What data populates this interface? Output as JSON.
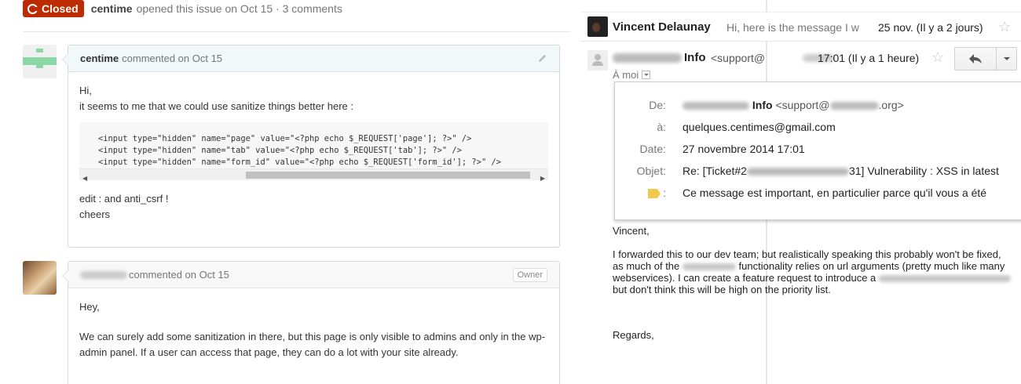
{
  "issue": {
    "state": "Closed",
    "author": "centime",
    "meta": "opened this issue on Oct 15 · 3 comments"
  },
  "comments": [
    {
      "author": "centime",
      "meta": "commented on Oct 15",
      "intro_1": "Hi,",
      "intro_2": "it seems to me that we could use sanitize things better here :",
      "code": "<input type=\"hidden\" name=\"page\" value=\"<?php echo $_REQUEST['page']; ?>\" />\n<input type=\"hidden\" name=\"tab\" value=\"<?php echo $_REQUEST['tab']; ?>\" />\n<input type=\"hidden\" name=\"form_id\" value=\"<?php echo $_REQUEST['form_id']; ?>\" />",
      "outro_1": "edit : and anti_csrf !",
      "outro_2": "cheers"
    },
    {
      "meta": "commented on Oct 15",
      "badge": "Owner",
      "p1": "Hey,",
      "p2": "We can surely add some sanitization in there, but this page is only visible to admins and only in the wp-admin panel. If a user can access that page, they can do a lot with your site already."
    }
  ],
  "mail": {
    "thread_sender": "Vincent Delaunay",
    "thread_snippet": "Hi, here is the message I w",
    "thread_date": "25 nov. (Il y a 2 jours)",
    "from_name": "Info",
    "from_addr": "<support@",
    "date": "17:01 (Il y a 1 heure)",
    "to_me": "À moi",
    "details": {
      "from_label": "De:",
      "from_name": "Info",
      "from_addr_start": "<support@",
      "from_addr_end": ".org>",
      "to_label": "à:",
      "to_value": "quelques.centimes@gmail.com",
      "date_label": "Date:",
      "date_value": "27 novembre 2014 17:01",
      "subject_label": "Objet:",
      "subject_start": "Re: [Ticket#2",
      "subject_end": "31] Vulnerability : XSS in latest",
      "importance_label": ":",
      "importance_value": "Ce message est important, en particulier parce qu'il vous a été"
    },
    "body": {
      "greeting": "Vincent,",
      "p1_a": "I forwarded this to our dev team; but realistically speaking this probably won't be fixed, as much of the",
      "p1_b": "functionality relies on url arguments (pretty much like many webservices). I can create a feature request to introduce a",
      "p1_c": "but don't think this will be high on the priority list.",
      "closing": "Regards,"
    }
  }
}
